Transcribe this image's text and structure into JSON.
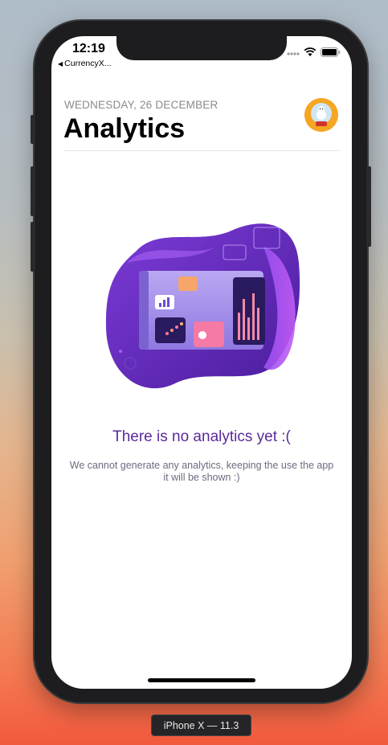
{
  "status_bar": {
    "time": "12:19",
    "back_app": "CurrencyX..."
  },
  "header": {
    "date": "WEDNESDAY, 26 DECEMBER",
    "title": "Analytics"
  },
  "empty_state": {
    "title": "There is no analytics yet :(",
    "description": "We cannot generate any analytics, keeping the use the app it will be shown :)"
  },
  "simulator": {
    "device_label": "iPhone X — 11.3"
  },
  "colors": {
    "accent_purple": "#5a2a9a",
    "avatar_orange": "#f5a623"
  },
  "icons": [
    "back-chevron-icon",
    "signal-icon",
    "wifi-icon",
    "battery-icon",
    "avatar-icon",
    "analytics-illustration"
  ]
}
